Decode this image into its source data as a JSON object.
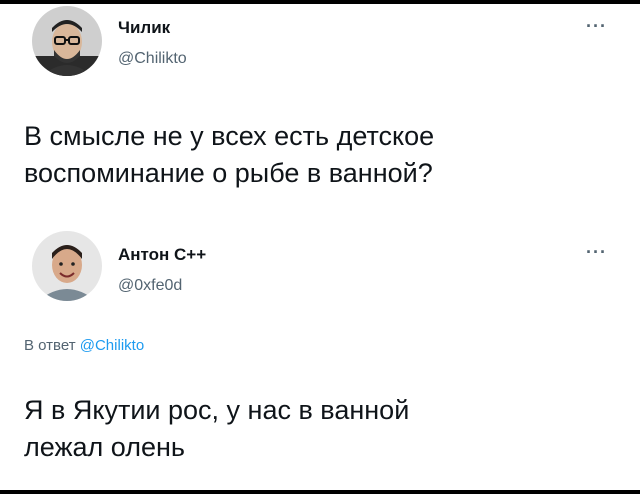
{
  "tweet": {
    "author_name": "Чилик",
    "author_handle": "@Chiliktо",
    "more_label": "···",
    "text_line1": "В смысле не у всех есть детское",
    "text_line2": "воспоминание о рыбе в ванной?"
  },
  "reply_tweet": {
    "author_name": "Антон С++",
    "author_handle": "@0xfe0d",
    "more_label": "···",
    "replying_prefix": "В ответ",
    "replying_handle": "@Chiliktо",
    "text_line1": "Я в Якутии рос, у нас в ванной",
    "text_line2": "лежал олень"
  },
  "icons": {
    "avatar1": "avatar-man-glasses-icon",
    "avatar2": "avatar-man-smiling-icon"
  }
}
